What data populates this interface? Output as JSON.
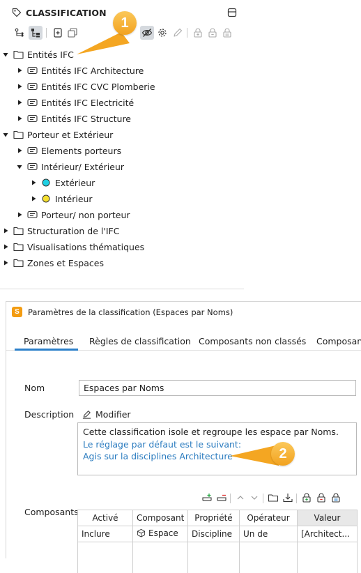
{
  "classification_panel": {
    "title": "CLASSIFICATION",
    "toolbar_icons": [
      "tree-hierarchy-icon",
      "tree-list-icon",
      "add-item-icon",
      "copy-icon",
      "visibility-off-icon",
      "gear-icon",
      "pencil-icon",
      "lock-add-icon",
      "lock-remove-icon",
      "lock-icon"
    ],
    "tree": [
      {
        "label": "Entités IFC",
        "level": 0,
        "expanded": true,
        "icon": "folder-icon"
      },
      {
        "label": "Entités IFC Architecture",
        "level": 1,
        "expanded": false,
        "icon": "label-icon"
      },
      {
        "label": "Entités IFC CVC Plomberie",
        "level": 1,
        "expanded": false,
        "icon": "label-icon"
      },
      {
        "label": "Entités IFC Electricité",
        "level": 1,
        "expanded": false,
        "icon": "label-icon"
      },
      {
        "label": "Entités IFC Structure",
        "level": 1,
        "expanded": false,
        "icon": "label-icon"
      },
      {
        "label": "Porteur et Extérieur",
        "level": 0,
        "expanded": true,
        "icon": "folder-icon"
      },
      {
        "label": "Elements porteurs",
        "level": 1,
        "expanded": false,
        "icon": "label-icon"
      },
      {
        "label": "Intérieur/ Extérieur",
        "level": 1,
        "expanded": true,
        "icon": "label-icon"
      },
      {
        "label": "Extérieur",
        "level": 2,
        "expanded": false,
        "icon": "circle-cyan-icon"
      },
      {
        "label": "Intérieur",
        "level": 2,
        "expanded": false,
        "icon": "circle-yellow-icon"
      },
      {
        "label": "Porteur/ non porteur",
        "level": 1,
        "expanded": false,
        "icon": "label-icon"
      },
      {
        "label": "Structuration de l'IFC",
        "level": 0,
        "expanded": false,
        "icon": "folder-icon"
      },
      {
        "label": "Visualisations thématiques",
        "level": 0,
        "expanded": false,
        "icon": "folder-icon"
      },
      {
        "label": "Zones et Espaces",
        "level": 0,
        "expanded": false,
        "icon": "folder-icon"
      }
    ]
  },
  "dialog": {
    "app_icon_letter": "S",
    "title": "Paramètres de la classification (Espaces par Noms)",
    "tabs": [
      "Paramètres",
      "Règles de classification",
      "Composants non classés",
      "Composant"
    ],
    "active_tab": "Paramètres",
    "name_label": "Nom",
    "name_value": "Espaces par Noms",
    "description_label": "Description",
    "modify_label": "Modifier",
    "description_line1": "Cette classification isole et regroupe les espace par Noms.",
    "description_line2": "Le réglage par défaut est le suivant:",
    "description_line3": "Agis sur la disciplines Architecture",
    "components_label": "Composants",
    "table_headers": [
      "Activé",
      "Composant",
      "Propriété",
      "Opérateur",
      "Valeur"
    ],
    "table_rows": [
      {
        "active": "Inclure",
        "component": "Espace",
        "property": "Discipline",
        "operator": "Un de",
        "value": "[Architect..."
      }
    ]
  },
  "callouts": [
    "1",
    "2"
  ],
  "colors": {
    "accent_blue": "#2a7fc9",
    "link_blue": "#2a7bbf",
    "callout_orange": "#f4a622",
    "circle_cyan": "#1fd0e3",
    "circle_yellow": "#f5df2e",
    "app_icon_orange": "#f39c12"
  }
}
